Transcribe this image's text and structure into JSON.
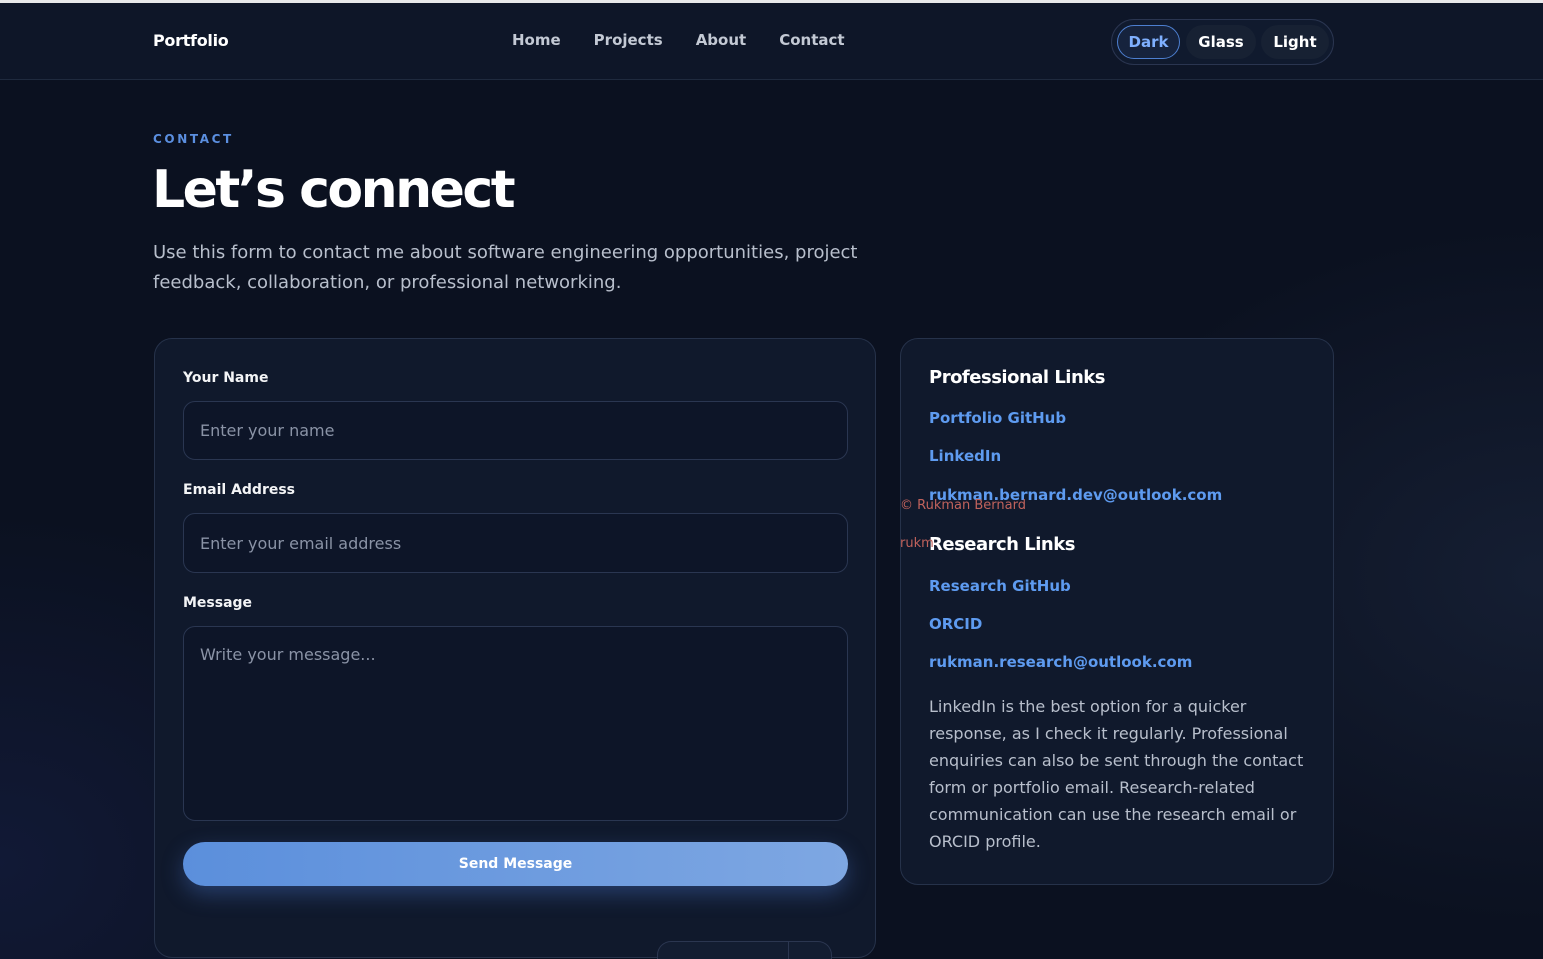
{
  "nav": {
    "brand": "Portfolio",
    "links": [
      "Home",
      "Projects",
      "About",
      "Contact"
    ],
    "theme_options": [
      "Dark",
      "Glass",
      "Light"
    ],
    "active_theme": "Dark"
  },
  "header": {
    "eyebrow": "CONTACT",
    "title": "Let’s connect",
    "lead": "Use this form to contact me about software engineering opportunities, project feedback, collaboration, or professional networking."
  },
  "form": {
    "name_label": "Your Name",
    "name_placeholder": "Enter your name",
    "email_label": "Email Address",
    "email_placeholder": "Enter your email address",
    "message_label": "Message",
    "message_placeholder": "Write your message...",
    "submit_label": "Send Message"
  },
  "links": {
    "professional_title": "Professional Links",
    "professional": [
      "Portfolio GitHub",
      "LinkedIn",
      "rukman.bernard.dev@outlook.com"
    ],
    "research_title": "Research Links",
    "research": [
      "Research GitHub",
      "ORCID",
      "rukman.research@outlook.com"
    ],
    "note": "LinkedIn is the best option for a quicker response, as I check it regularly. Professional enquiries can also be sent through the contact form or portfolio email. Research-related communication can use the research email or ORCID profile."
  },
  "overlay": {
    "copyright": "© Rukman Bernard",
    "partial_email": "rukm"
  }
}
